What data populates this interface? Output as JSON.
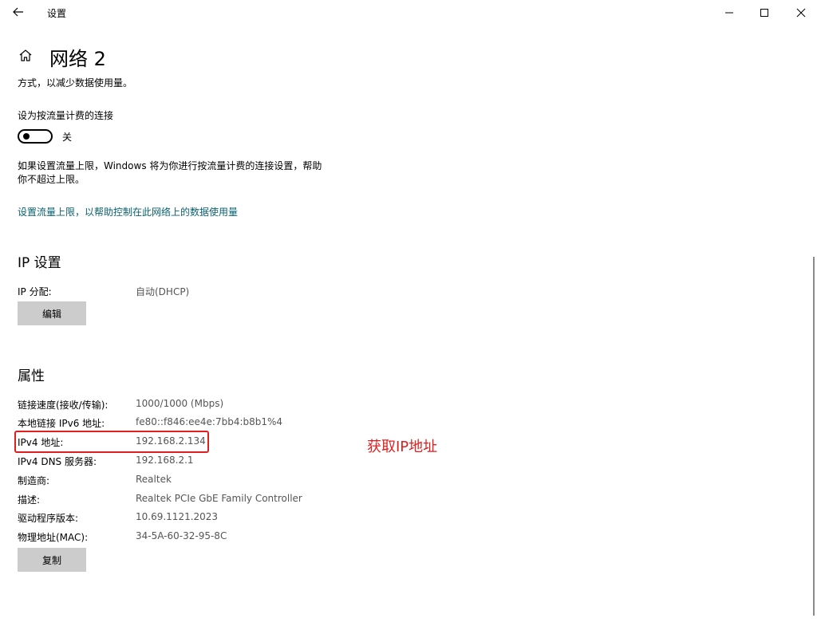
{
  "window": {
    "title": "设置",
    "controls": {
      "minimize": "minimize-icon",
      "maximize": "maximize-icon",
      "close": "close-icon"
    }
  },
  "header": {
    "title": "网络 2",
    "icon": "home-icon"
  },
  "metered": {
    "desc_top": "方式，以减少数据使用量。",
    "label": "设为按流量计费的连接",
    "toggle_state": "关",
    "info_line1": "如果设置流量上限，Windows 将为你进行按流量计费的连接设置，帮助",
    "info_line2": "你不超过上限。",
    "link": "设置流量上限，以帮助控制在此网络上的数据使用量"
  },
  "ip_settings": {
    "heading": "IP 设置",
    "label": "IP 分配:",
    "value": "自动(DHCP)",
    "edit_button": "编辑"
  },
  "properties": {
    "heading": "属性",
    "rows": [
      {
        "label": "链接速度(接收/传输):",
        "value": "1000/1000 (Mbps)"
      },
      {
        "label": "本地链接 IPv6 地址:",
        "value": "fe80::f846:ee4e:7bb4:b8b1%4"
      },
      {
        "label": "IPv4 地址:",
        "value": "192.168.2.134"
      },
      {
        "label": "IPv4 DNS 服务器:",
        "value": "192.168.2.1"
      },
      {
        "label": "制造商:",
        "value": "Realtek"
      },
      {
        "label": "描述:",
        "value": "Realtek PCIe GbE Family Controller"
      },
      {
        "label": "驱动程序版本:",
        "value": "10.69.1121.2023"
      },
      {
        "label": "物理地址(MAC):",
        "value": "34-5A-60-32-95-8C"
      }
    ],
    "copy_button": "复制"
  },
  "annotation": {
    "text": "获取IP地址",
    "color": "#e02020"
  },
  "colors": {
    "link": "#0a6270",
    "button_bg": "#cccccc",
    "annotation": "#e02020"
  }
}
